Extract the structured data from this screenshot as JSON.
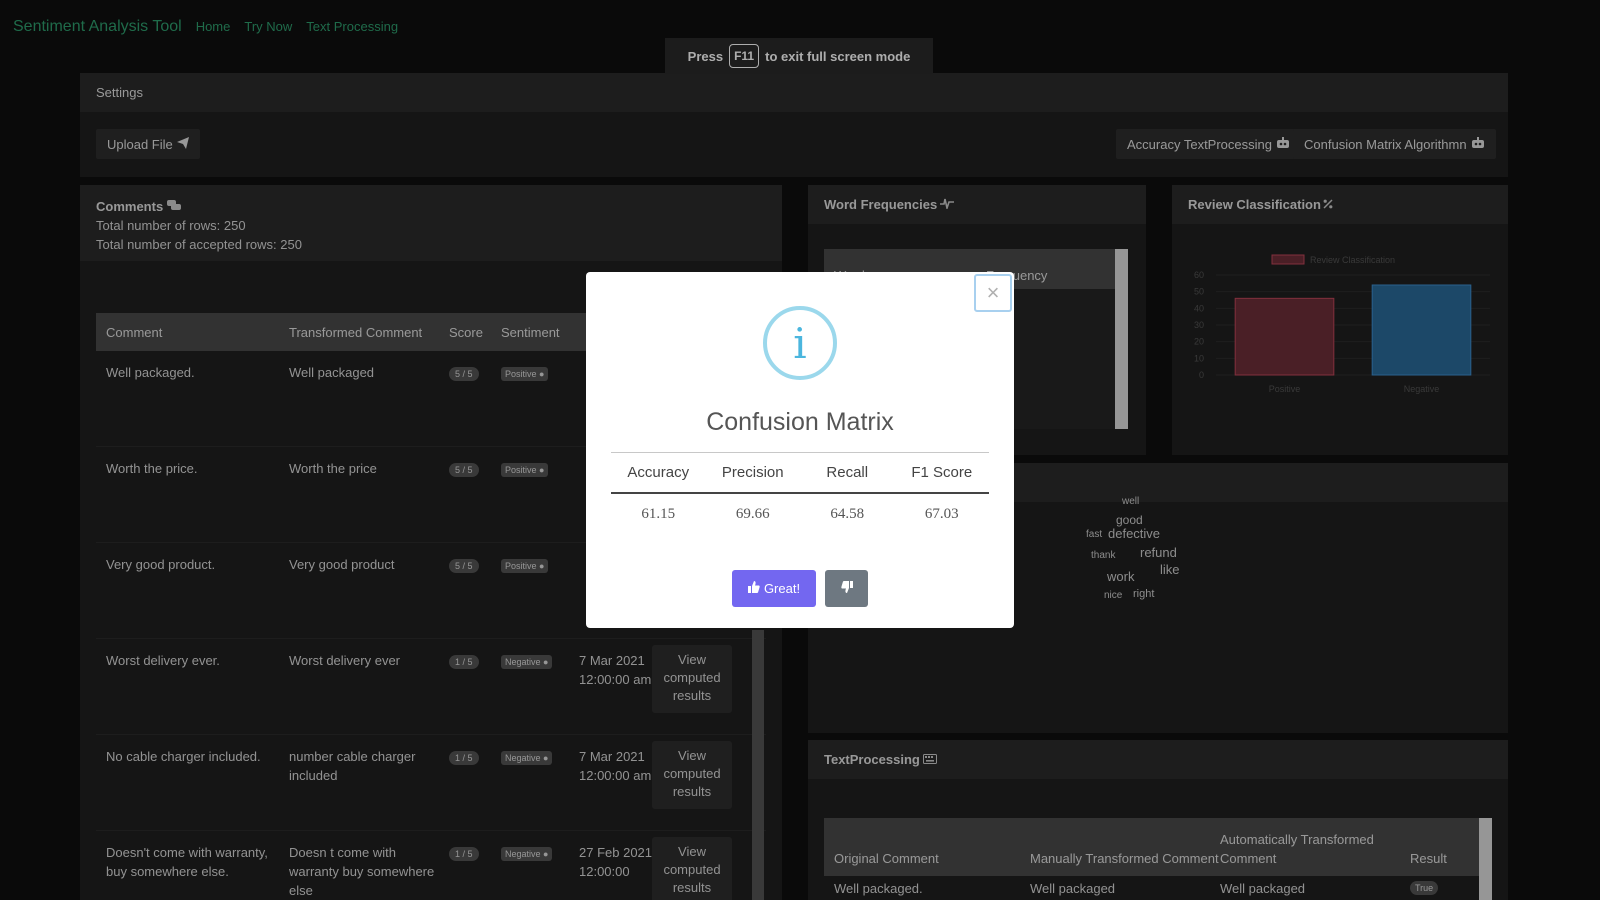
{
  "nav": {
    "brand": "Sentiment Analysis Tool",
    "links": [
      "Home",
      "Try Now",
      "Text Processing"
    ]
  },
  "toast": {
    "pre": "Press",
    "key": "F11",
    "post": "to exit full screen mode"
  },
  "settings": {
    "title": "Settings",
    "upload_label": "Upload File",
    "accuracy_label": "Accuracy TextProcessing",
    "confusion_label": "Confusion Matrix Algorithmn"
  },
  "comments": {
    "title": "Comments",
    "total_rows": "Total number of rows: 250",
    "accepted_rows": "Total number of accepted rows: 250",
    "headers": [
      "Comment",
      "Transformed Comment",
      "Score",
      "Sentiment"
    ],
    "rows": [
      {
        "comment": "Well packaged.",
        "transformed": "Well packaged",
        "score": "5 / 5",
        "sentiment": "Positive",
        "date": "",
        "action": ""
      },
      {
        "comment": "Worth the price.",
        "transformed": "Worth the price",
        "score": "5 / 5",
        "sentiment": "Positive",
        "date": "",
        "action": ""
      },
      {
        "comment": "Very good product.",
        "transformed": "Very good product",
        "score": "5 / 5",
        "sentiment": "Positive",
        "date": "",
        "action": ""
      },
      {
        "comment": "Worst delivery ever.",
        "transformed": "Worst delivery ever",
        "score": "1 / 5",
        "sentiment": "Negative",
        "date": "7 Mar 2021 12:00:00 am",
        "action": "View computed results"
      },
      {
        "comment": "No cable charger included.",
        "transformed": "number cable charger included",
        "score": "1 / 5",
        "sentiment": "Negative",
        "date": "7 Mar 2021 12:00:00 am",
        "action": "View computed results"
      },
      {
        "comment": "Doesn't come with warranty, buy somewhere else.",
        "transformed": "Doesn t come with warranty buy somewhere else",
        "score": "1 / 5",
        "sentiment": "Negative",
        "date": "27 Feb 2021 12:00:00",
        "action": "View computed results"
      }
    ]
  },
  "word_frequencies": {
    "title": "Word Frequencies",
    "headers": [
      "Word",
      "Frequency"
    ]
  },
  "review_classification": {
    "title": "Review Classification",
    "chart_data": {
      "type": "bar",
      "categories": [
        "Positive",
        "Negative"
      ],
      "series": [
        {
          "name": "Review Classification",
          "values": [
            46,
            54
          ]
        }
      ],
      "ylim": [
        0,
        60
      ],
      "yticks": [
        0,
        10,
        20,
        30,
        40,
        50,
        60
      ],
      "colors": [
        "#6e2e38",
        "#2a6a9a"
      ],
      "border_colors": [
        "#c0485a",
        "#3f8fd0"
      ],
      "legend": "top"
    }
  },
  "word_cloud": {
    "words": [
      "well",
      "good",
      "fast",
      "defective",
      "thank",
      "refund",
      "like",
      "work",
      "nice",
      "right"
    ]
  },
  "text_processing": {
    "title": "TextProcessing",
    "headers": [
      "Original Comment",
      "Manually Transformed Comment",
      "Automatically Transformed Comment",
      "Result"
    ],
    "rows": [
      {
        "original": "Well packaged.",
        "manual": "Well packaged",
        "auto": "Well packaged",
        "result": "True"
      }
    ]
  },
  "modal": {
    "title": "Confusion Matrix",
    "icon_glyph": "i",
    "close_glyph": "×",
    "headers": [
      "Accuracy",
      "Precision",
      "Recall",
      "F1 Score"
    ],
    "values": [
      "61.15",
      "69.66",
      "64.58",
      "67.03"
    ],
    "great_label": "Great!"
  }
}
